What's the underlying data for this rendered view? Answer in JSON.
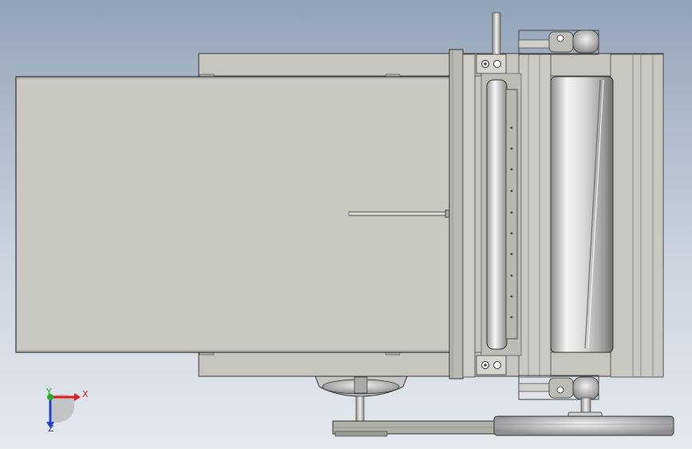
{
  "viewport": {
    "background_top": "#93a3b8",
    "background_bottom": "#e6e9ee"
  },
  "colors": {
    "plate": "#c8c8c0",
    "plate_dark": "#b4b4ac",
    "edge": "#3a3a3a",
    "frame": "#8e8e86",
    "steel_light": "#f2f2f2",
    "steel_dark": "#9a9a9a"
  },
  "triad": {
    "x_label": "X",
    "y_label": "Y",
    "z_label": "Z",
    "x_color": "#e02020",
    "y_color": "#20b020",
    "z_color": "#2040d0"
  },
  "parts": {
    "conveyor_belt": "conveyor-belt",
    "rear_frame": "rear-frame",
    "drive_roller": "drive-roller",
    "idler_roller": "idler-roller",
    "drive_pulley": "drive-pulley",
    "motor": "motor"
  }
}
